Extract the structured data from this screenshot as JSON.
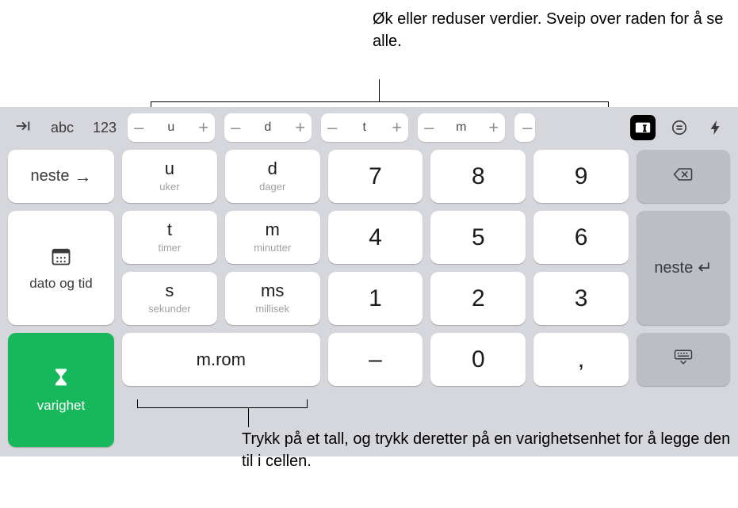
{
  "callouts": {
    "top": "Øk eller reduser verdier. Sveip over raden for å se alle.",
    "bottom": "Trykk på et tall, og trykk deretter på en varighetsenhet for å legge den til i cellen."
  },
  "toprow": {
    "mode_abc": "abc",
    "mode_123": "123",
    "steppers": [
      "u",
      "d",
      "t",
      "m"
    ],
    "partial_stepper": "–"
  },
  "left_keys": {
    "next_label": "neste",
    "datetime_label": "dato og tid",
    "duration_label": "varighet"
  },
  "unit_keys": [
    {
      "main": "u",
      "sub": "uker"
    },
    {
      "main": "d",
      "sub": "dager"
    },
    {
      "main": "t",
      "sub": "timer"
    },
    {
      "main": "m",
      "sub": "minutter"
    },
    {
      "main": "s",
      "sub": "sekunder"
    },
    {
      "main": "ms",
      "sub": "millisek"
    }
  ],
  "numpad": {
    "r1": [
      "7",
      "8",
      "9"
    ],
    "r2": [
      "4",
      "5",
      "6"
    ],
    "r3": [
      "1",
      "2",
      "3"
    ],
    "r4": [
      "–",
      "0",
      ","
    ]
  },
  "space_key": "m.rom",
  "right_keys": {
    "next_label": "neste"
  }
}
